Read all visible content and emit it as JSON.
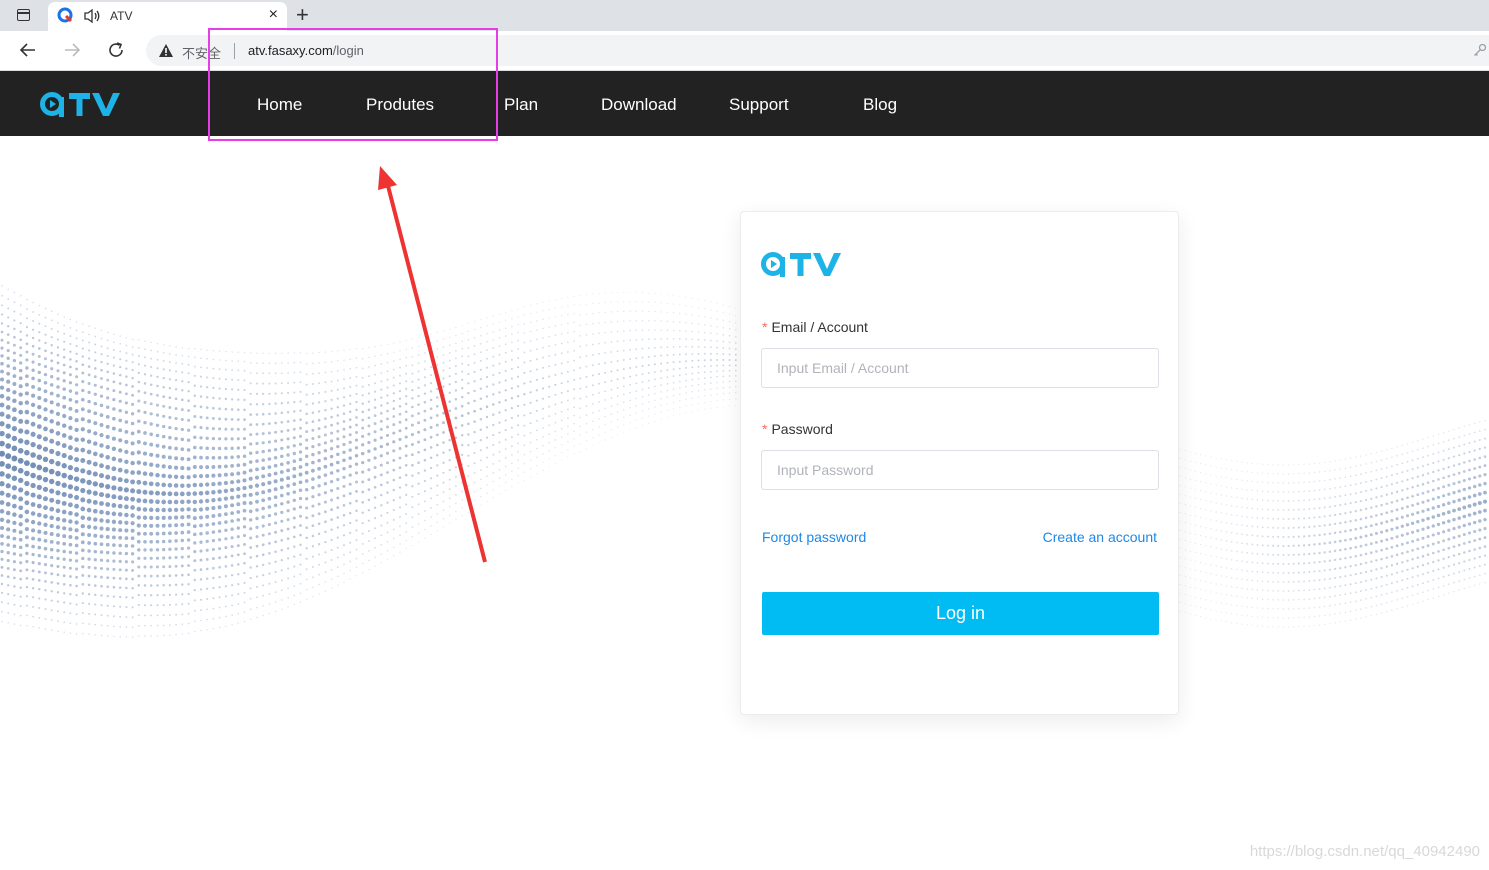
{
  "browser": {
    "tab_title": "ATV",
    "new_tab_symbol": "+",
    "close_symbol": "×",
    "insecure_text": "不安全",
    "url_host": "atv.fasaxy.com",
    "url_path": "/login"
  },
  "site": {
    "logo_text": "ATV",
    "brand_color": "#1eb3e6",
    "nav": [
      "Home",
      "Produtes",
      "Plan",
      "Download",
      "Support",
      "Blog"
    ]
  },
  "login": {
    "email_label": "Email / Account",
    "email_placeholder": "Input Email / Account",
    "password_label": "Password",
    "password_placeholder": "Input Password",
    "required_mark": "*",
    "forgot_label": "Forgot password",
    "create_label": "Create an account",
    "login_label": "Log in",
    "button_color": "#00bcf2"
  },
  "annotation": {
    "box_color": "#e43fe6",
    "arrow_color": "#ee3333"
  },
  "watermark": "https://blog.csdn.net/qq_40942490"
}
